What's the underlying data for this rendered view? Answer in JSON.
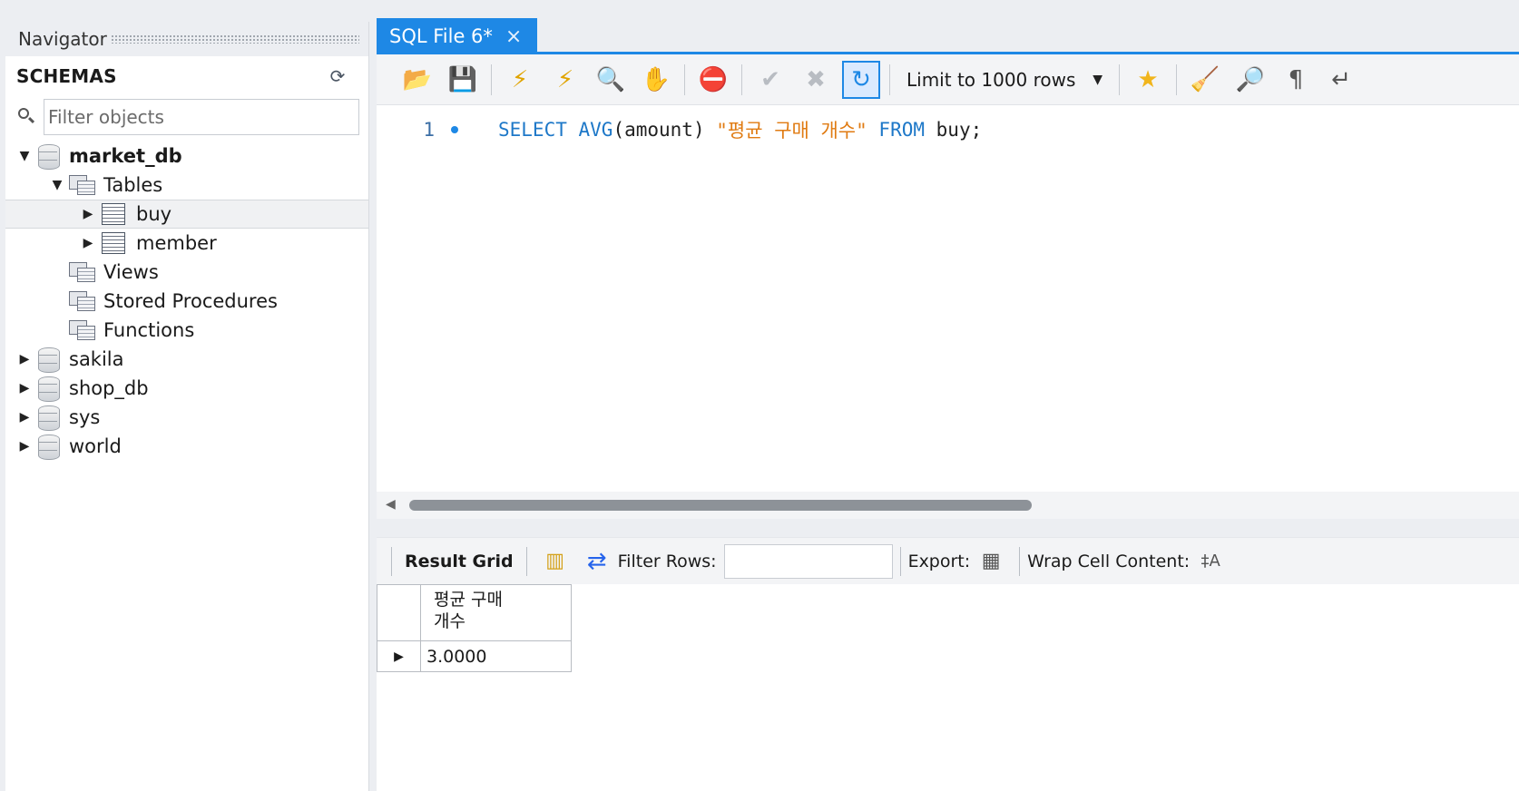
{
  "navigator": {
    "title": "Navigator",
    "schemas_label": "SCHEMAS",
    "filter_placeholder": "Filter objects",
    "tree": {
      "market_db": "market_db",
      "tables": "Tables",
      "buy": "buy",
      "member": "member",
      "views": "Views",
      "stored_procedures": "Stored Procedures",
      "functions": "Functions",
      "sakila": "sakila",
      "shop_db": "shop_db",
      "sys": "sys",
      "world": "world"
    }
  },
  "editor": {
    "tab_label": "SQL File 6*",
    "tab_close": "×",
    "limit_label": "Limit to 1000 rows",
    "code": {
      "line_number": "1",
      "kw_select": "SELECT",
      "fn_avg": "AVG",
      "args": "(amount)",
      "alias": "\"평균 구매 개수\"",
      "kw_from": "FROM",
      "table": "buy;"
    }
  },
  "results": {
    "result_grid_label": "Result Grid",
    "filter_rows_label": "Filter Rows:",
    "export_label": "Export:",
    "wrap_label": "Wrap Cell Content:",
    "column_header_line1": "평균 구매",
    "column_header_line2": "개수",
    "cell_value": "3.0000"
  },
  "colors": {
    "accent": "#1e88e5",
    "keyword": "#1e78c8",
    "string": "#e07b12"
  },
  "icons": [
    "refresh-icon",
    "search-icon",
    "open-folder-icon",
    "save-icon",
    "execute-icon",
    "execute-current-icon",
    "explain-icon",
    "stop-icon",
    "toggle-error-icon",
    "commit-icon",
    "rollback-icon",
    "autocommit-icon",
    "bookmark-icon",
    "beautify-icon",
    "find-icon",
    "invisible-chars-icon",
    "wrap-icon"
  ]
}
